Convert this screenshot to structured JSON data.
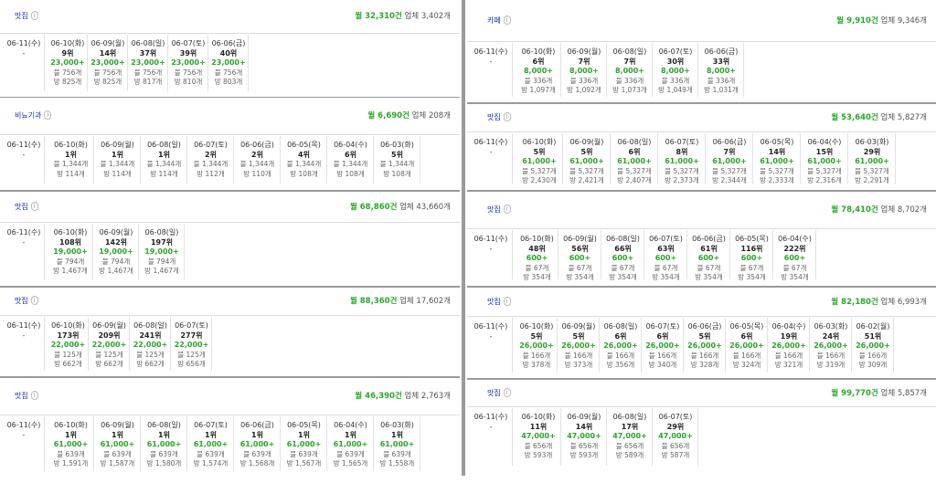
{
  "info_label": "i",
  "today_date": "06-11(수)",
  "today_value": "-",
  "panels": [
    {
      "keyword": "맛집",
      "volume": "월 32,310건",
      "biz": "업체 3,402개",
      "cols": [
        [
          "06-10(화)",
          "9위",
          "23,000+",
          "블 756개",
          "방 825개"
        ],
        [
          "06-09(월)",
          "14위",
          "23,000+",
          "블 756개",
          "방 825개"
        ],
        [
          "06-08(일)",
          "37위",
          "23,000+",
          "블 756개",
          "방 817개"
        ],
        [
          "06-07(토)",
          "39위",
          "23,000+",
          "블 756개",
          "방 810개"
        ],
        [
          "06-06(금)",
          "40위",
          "23,000+",
          "블 756개",
          "방 803개"
        ]
      ]
    },
    {
      "keyword": "비뇨기과",
      "volume": "월 6,690건",
      "biz": "업체 208개",
      "cols": [
        [
          "06-10(화)",
          "1위",
          "블 1,344개",
          "",
          "방 114개"
        ],
        [
          "06-09(월)",
          "1위",
          "블 1,344개",
          "",
          "방 114개"
        ],
        [
          "06-08(일)",
          "1위",
          "블 1,344개",
          "",
          "방 114개"
        ],
        [
          "06-07(토)",
          "2위",
          "블 1,344개",
          "",
          "방 112개"
        ],
        [
          "06-06(금)",
          "2위",
          "블 1,344개",
          "",
          "방 110개"
        ],
        [
          "06-05(목)",
          "4위",
          "블 1,344개",
          "",
          "방 108개"
        ],
        [
          "06-04(수)",
          "6위",
          "블 1,344개",
          "",
          "방 108개"
        ],
        [
          "06-03(화)",
          "5위",
          "블 1,344개",
          "",
          "방 108개"
        ]
      ]
    },
    {
      "keyword": "맛집",
      "volume": "월 68,860건",
      "biz": "업체 43,660개",
      "cols": [
        [
          "06-10(화)",
          "108위",
          "19,000+",
          "블 794개",
          "방 1,467개"
        ],
        [
          "06-09(월)",
          "142위",
          "19,000+",
          "블 794개",
          "방 1,467개"
        ],
        [
          "06-08(일)",
          "197위",
          "19,000+",
          "블 794개",
          "방 1,467개"
        ]
      ]
    },
    {
      "keyword": "맛집",
      "volume": "월 88,360건",
      "biz": "업체 17,602개",
      "cols": [
        [
          "06-10(화)",
          "173위",
          "22,000+",
          "블 125개",
          "방 662개"
        ],
        [
          "06-09(월)",
          "209위",
          "22,000+",
          "블 125개",
          "방 662개"
        ],
        [
          "06-08(일)",
          "241위",
          "22,000+",
          "블 125개",
          "방 662개"
        ],
        [
          "06-07(토)",
          "277위",
          "22,000+",
          "블 125개",
          "방 656개"
        ]
      ]
    },
    {
      "keyword": "맛집",
      "volume": "월 46,390건",
      "biz": "업체 2,763개",
      "cols": [
        [
          "06-10(화)",
          "1위",
          "61,000+",
          "블 639개",
          "방 1,591개"
        ],
        [
          "06-09(월)",
          "1위",
          "61,000+",
          "블 639개",
          "방 1,587개"
        ],
        [
          "06-08(일)",
          "1위",
          "61,000+",
          "블 639개",
          "방 1,580개"
        ],
        [
          "06-07(토)",
          "1위",
          "61,000+",
          "블 639개",
          "방 1,574개"
        ],
        [
          "06-06(금)",
          "1위",
          "61,000+",
          "블 639개",
          "방 1,568개"
        ],
        [
          "06-05(목)",
          "1위",
          "61,000+",
          "블 639개",
          "방 1,567개"
        ],
        [
          "06-04(수)",
          "1위",
          "61,000+",
          "블 639개",
          "방 1,565개"
        ],
        [
          "06-03(화)",
          "1위",
          "61,000+",
          "블 639개",
          "방 1,558개"
        ]
      ]
    },
    {
      "keyword": "카페",
      "volume": "월 9,910건",
      "biz": "업체 9,346개",
      "cols": [
        [
          "06-10(화)",
          "6위",
          "8,000+",
          "블 336개",
          "방 1,097개"
        ],
        [
          "06-09(월)",
          "7위",
          "8,000+",
          "블 336개",
          "방 1,092개"
        ],
        [
          "06-08(일)",
          "7위",
          "8,000+",
          "블 336개",
          "방 1,073개"
        ],
        [
          "06-07(토)",
          "30위",
          "8,000+",
          "블 336개",
          "방 1,049개"
        ],
        [
          "06-06(금)",
          "33위",
          "8,000+",
          "블 336개",
          "방 1,031개"
        ]
      ]
    },
    {
      "keyword": "맛집",
      "volume": "월 53,640건",
      "biz": "업체 5,827개",
      "cols": [
        [
          "06-10(화)",
          "5위",
          "61,000+",
          "블 5,327개",
          "방 2,430개"
        ],
        [
          "06-09(월)",
          "5위",
          "61,000+",
          "블 5,327개",
          "방 2,421개"
        ],
        [
          "06-08(일)",
          "6위",
          "61,000+",
          "블 5,327개",
          "방 2,407개"
        ],
        [
          "06-07(토)",
          "8위",
          "61,000+",
          "블 5,327개",
          "방 2,373개"
        ],
        [
          "06-06(금)",
          "7위",
          "61,000+",
          "블 5,327개",
          "방 2,344개"
        ],
        [
          "06-05(목)",
          "14위",
          "61,000+",
          "블 5,327개",
          "방 2,333개"
        ],
        [
          "06-04(수)",
          "15위",
          "61,000+",
          "블 5,327개",
          "방 2,316개"
        ],
        [
          "06-03(화)",
          "29위",
          "61,000+",
          "블 5,327개",
          "방 2,291개"
        ]
      ]
    },
    {
      "keyword": "맛집",
      "volume": "월 78,410건",
      "biz": "업체 8,702개",
      "cols": [
        [
          "06-10(화)",
          "48위",
          "600+",
          "블 67개",
          "방 354개"
        ],
        [
          "06-09(월)",
          "56위",
          "600+",
          "블 67개",
          "방 354개"
        ],
        [
          "06-08(일)",
          "66위",
          "600+",
          "블 67개",
          "방 354개"
        ],
        [
          "06-07(토)",
          "63위",
          "600+",
          "블 67개",
          "방 354개"
        ],
        [
          "06-06(금)",
          "61위",
          "600+",
          "블 67개",
          "방 354개"
        ],
        [
          "06-05(목)",
          "116위",
          "600+",
          "블 67개",
          "방 354개"
        ],
        [
          "06-04(수)",
          "222위",
          "600+",
          "블 67개",
          "방 354개"
        ]
      ]
    },
    {
      "keyword": "맛집",
      "volume": "월 82,180건",
      "biz": "업체 6,993개",
      "cols": [
        [
          "06-10(화)",
          "5위",
          "26,000+",
          "블 166개",
          "방 378개"
        ],
        [
          "06-09(월)",
          "5위",
          "26,000+",
          "블 166개",
          "방 373개"
        ],
        [
          "06-08(일)",
          "6위",
          "26,000+",
          "블 166개",
          "방 356개"
        ],
        [
          "06-07(토)",
          "6위",
          "26,000+",
          "블 166개",
          "방 340개"
        ],
        [
          "06-06(금)",
          "5위",
          "26,000+",
          "블 166개",
          "방 328개"
        ],
        [
          "06-05(목)",
          "6위",
          "26,000+",
          "블 166개",
          "방 324개"
        ],
        [
          "06-04(수)",
          "19위",
          "26,000+",
          "블 166개",
          "방 321개"
        ],
        [
          "06-03(화)",
          "24위",
          "26,000+",
          "블 166개",
          "방 319개"
        ],
        [
          "06-02(월)",
          "51위",
          "26,000+",
          "블 166개",
          "방 309개"
        ]
      ]
    },
    {
      "keyword": "맛집",
      "volume": "월 99,770건",
      "biz": "업체 5,857개",
      "cols": [
        [
          "06-10(화)",
          "11위",
          "47,000+",
          "블 656개",
          "방 593개"
        ],
        [
          "06-09(월)",
          "14위",
          "47,000+",
          "블 656개",
          "방 593개"
        ],
        [
          "06-08(일)",
          "17위",
          "47,000+",
          "블 656개",
          "방 589개"
        ],
        [
          "06-07(토)",
          "29위",
          "47,000+",
          "블 656개",
          "방 587개"
        ]
      ]
    }
  ]
}
